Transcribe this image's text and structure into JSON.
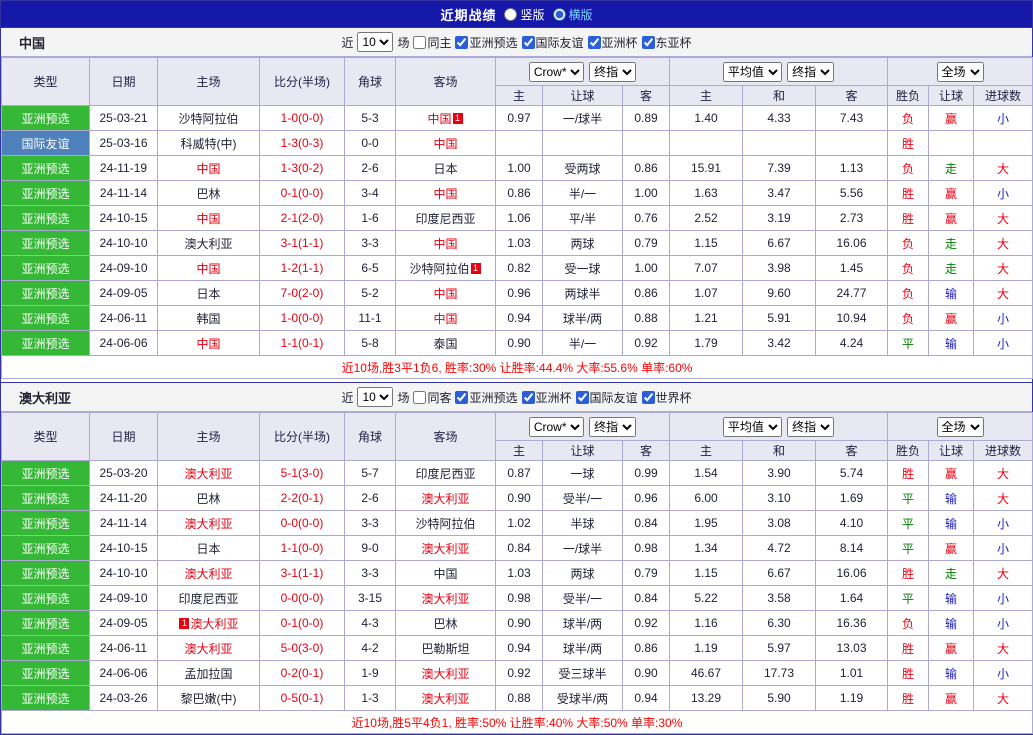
{
  "colors": {
    "topbar_bg": "#1518a8",
    "type_green": "#35b835",
    "type_blue": "#4f81bd",
    "red": "#e60012",
    "green": "#008000",
    "blue": "#2020cc",
    "header_bg": "#e8e8f2",
    "border": "#aaaad4",
    "selected_layout_label": "#7fd4ff",
    "summary_text": "#ff0000"
  },
  "topbar": {
    "title": "近期战绩",
    "options": [
      {
        "label": "竖版",
        "selected": false
      },
      {
        "label": "横版",
        "selected": true
      }
    ]
  },
  "sections": [
    {
      "team": "中国",
      "filter": {
        "near_label": "近",
        "count": "10",
        "games_label": "场",
        "same": {
          "label": "同主",
          "checked": false
        },
        "comps": [
          {
            "label": "亚洲预选",
            "checked": true
          },
          {
            "label": "国际友谊",
            "checked": true
          },
          {
            "label": "亚洲杯",
            "checked": true
          },
          {
            "label": "东亚杯",
            "checked": true
          }
        ]
      },
      "header": {
        "col_type": "类型",
        "col_date": "日期",
        "col_home": "主场",
        "col_score": "比分(半场)",
        "col_corner": "角球",
        "col_away": "客场",
        "odds_group1": [
          "Crow*",
          "终指"
        ],
        "odds_group2": [
          "平均值",
          "终指"
        ],
        "odds_group3": [
          "全场"
        ],
        "sub": [
          "主",
          "让球",
          "客",
          "主",
          "和",
          "客",
          "胜负",
          "让球",
          "进球数"
        ]
      },
      "rows": [
        {
          "type": "亚洲预选",
          "type_c": "green",
          "date": "25-03-21",
          "home": {
            "name": "沙特阿拉伯"
          },
          "score": "1-0(0-0)",
          "corner": "5-3",
          "away": {
            "name": "中国",
            "red": true,
            "badge_post": "1"
          },
          "odds1": [
            "0.97",
            "一/球半",
            "0.89"
          ],
          "odds2": [
            "1.40",
            "4.33",
            "7.43"
          ],
          "res": {
            "t": "负",
            "c": "r"
          },
          "handicap": {
            "t": "赢",
            "c": "r"
          },
          "goals": {
            "t": "小",
            "c": "b"
          }
        },
        {
          "type": "国际友谊",
          "type_c": "blue",
          "date": "25-03-16",
          "home": {
            "name": "科威特(中)"
          },
          "score": "1-3(0-3)",
          "corner": "0-0",
          "away": {
            "name": "中国",
            "red": true
          },
          "odds1": [
            "",
            "",
            ""
          ],
          "odds2": [
            "",
            "",
            ""
          ],
          "res": {
            "t": "胜",
            "c": "r"
          },
          "handicap": {
            "t": "",
            "c": "k"
          },
          "goals": {
            "t": "",
            "c": "k"
          }
        },
        {
          "type": "亚洲预选",
          "type_c": "green",
          "date": "24-11-19",
          "home": {
            "name": "中国",
            "red": true
          },
          "score": "1-3(0-2)",
          "corner": "2-6",
          "away": {
            "name": "日本"
          },
          "odds1": [
            "1.00",
            "受两球",
            "0.86"
          ],
          "odds2": [
            "15.91",
            "7.39",
            "1.13"
          ],
          "res": {
            "t": "负",
            "c": "r"
          },
          "handicap": {
            "t": "走",
            "c": "g"
          },
          "goals": {
            "t": "大",
            "c": "r"
          }
        },
        {
          "type": "亚洲预选",
          "type_c": "green",
          "date": "24-11-14",
          "home": {
            "name": "巴林"
          },
          "score": "0-1(0-0)",
          "corner": "3-4",
          "away": {
            "name": "中国",
            "red": true
          },
          "odds1": [
            "0.86",
            "半/一",
            "1.00"
          ],
          "odds2": [
            "1.63",
            "3.47",
            "5.56"
          ],
          "res": {
            "t": "胜",
            "c": "r"
          },
          "handicap": {
            "t": "赢",
            "c": "r"
          },
          "goals": {
            "t": "小",
            "c": "b"
          }
        },
        {
          "type": "亚洲预选",
          "type_c": "green",
          "date": "24-10-15",
          "home": {
            "name": "中国",
            "red": true
          },
          "score": "2-1(2-0)",
          "corner": "1-6",
          "away": {
            "name": "印度尼西亚"
          },
          "odds1": [
            "1.06",
            "平/半",
            "0.76"
          ],
          "odds2": [
            "2.52",
            "3.19",
            "2.73"
          ],
          "res": {
            "t": "胜",
            "c": "r"
          },
          "handicap": {
            "t": "赢",
            "c": "r"
          },
          "goals": {
            "t": "大",
            "c": "r"
          }
        },
        {
          "type": "亚洲预选",
          "type_c": "green",
          "date": "24-10-10",
          "home": {
            "name": "澳大利亚"
          },
          "score": "3-1(1-1)",
          "corner": "3-3",
          "away": {
            "name": "中国",
            "red": true
          },
          "odds1": [
            "1.03",
            "两球",
            "0.79"
          ],
          "odds2": [
            "1.15",
            "6.67",
            "16.06"
          ],
          "res": {
            "t": "负",
            "c": "r"
          },
          "handicap": {
            "t": "走",
            "c": "g"
          },
          "goals": {
            "t": "大",
            "c": "r"
          }
        },
        {
          "type": "亚洲预选",
          "type_c": "green",
          "date": "24-09-10",
          "home": {
            "name": "中国",
            "red": true
          },
          "score": "1-2(1-1)",
          "corner": "6-5",
          "away": {
            "name": "沙特阿拉伯",
            "badge_post": "1"
          },
          "odds1": [
            "0.82",
            "受一球",
            "1.00"
          ],
          "odds2": [
            "7.07",
            "3.98",
            "1.45"
          ],
          "res": {
            "t": "负",
            "c": "r"
          },
          "handicap": {
            "t": "走",
            "c": "g"
          },
          "goals": {
            "t": "大",
            "c": "r"
          }
        },
        {
          "type": "亚洲预选",
          "type_c": "green",
          "date": "24-09-05",
          "home": {
            "name": "日本"
          },
          "score": "7-0(2-0)",
          "corner": "5-2",
          "away": {
            "name": "中国",
            "red": true
          },
          "odds1": [
            "0.96",
            "两球半",
            "0.86"
          ],
          "odds2": [
            "1.07",
            "9.60",
            "24.77"
          ],
          "res": {
            "t": "负",
            "c": "r"
          },
          "handicap": {
            "t": "输",
            "c": "b"
          },
          "goals": {
            "t": "大",
            "c": "r"
          }
        },
        {
          "type": "亚洲预选",
          "type_c": "green",
          "date": "24-06-11",
          "home": {
            "name": "韩国"
          },
          "score": "1-0(0-0)",
          "corner": "11-1",
          "away": {
            "name": "中国",
            "red": true
          },
          "odds1": [
            "0.94",
            "球半/两",
            "0.88"
          ],
          "odds2": [
            "1.21",
            "5.91",
            "10.94"
          ],
          "res": {
            "t": "负",
            "c": "r"
          },
          "handicap": {
            "t": "赢",
            "c": "r"
          },
          "goals": {
            "t": "小",
            "c": "b"
          }
        },
        {
          "type": "亚洲预选",
          "type_c": "green",
          "date": "24-06-06",
          "home": {
            "name": "中国",
            "red": true
          },
          "score": "1-1(0-1)",
          "corner": "5-8",
          "away": {
            "name": "泰国"
          },
          "odds1": [
            "0.90",
            "半/一",
            "0.92"
          ],
          "odds2": [
            "1.79",
            "3.42",
            "4.24"
          ],
          "res": {
            "t": "平",
            "c": "g"
          },
          "handicap": {
            "t": "输",
            "c": "b"
          },
          "goals": {
            "t": "小",
            "c": "b"
          }
        }
      ],
      "summary": "近10场,胜3平1负6, 胜率:30% 让胜率:44.4% 大率:55.6% 单率:60%"
    },
    {
      "team": "澳大利亚",
      "filter": {
        "near_label": "近",
        "count": "10",
        "games_label": "场",
        "same": {
          "label": "同客",
          "checked": false
        },
        "comps": [
          {
            "label": "亚洲预选",
            "checked": true
          },
          {
            "label": "亚洲杯",
            "checked": true
          },
          {
            "label": "国际友谊",
            "checked": true
          },
          {
            "label": "世界杯",
            "checked": true
          }
        ]
      },
      "header": {
        "col_type": "类型",
        "col_date": "日期",
        "col_home": "主场",
        "col_score": "比分(半场)",
        "col_corner": "角球",
        "col_away": "客场",
        "odds_group1": [
          "Crow*",
          "终指"
        ],
        "odds_group2": [
          "平均值",
          "终指"
        ],
        "odds_group3": [
          "全场"
        ],
        "sub": [
          "主",
          "让球",
          "客",
          "主",
          "和",
          "客",
          "胜负",
          "让球",
          "进球数"
        ]
      },
      "rows": [
        {
          "type": "亚洲预选",
          "type_c": "green",
          "date": "25-03-20",
          "home": {
            "name": "澳大利亚",
            "red": true
          },
          "score": "5-1(3-0)",
          "corner": "5-7",
          "away": {
            "name": "印度尼西亚"
          },
          "odds1": [
            "0.87",
            "一球",
            "0.99"
          ],
          "odds2": [
            "1.54",
            "3.90",
            "5.74"
          ],
          "res": {
            "t": "胜",
            "c": "r"
          },
          "handicap": {
            "t": "赢",
            "c": "r"
          },
          "goals": {
            "t": "大",
            "c": "r"
          }
        },
        {
          "type": "亚洲预选",
          "type_c": "green",
          "date": "24-11-20",
          "home": {
            "name": "巴林"
          },
          "score": "2-2(0-1)",
          "corner": "2-6",
          "away": {
            "name": "澳大利亚",
            "red": true
          },
          "odds1": [
            "0.90",
            "受半/一",
            "0.96"
          ],
          "odds2": [
            "6.00",
            "3.10",
            "1.69"
          ],
          "res": {
            "t": "平",
            "c": "g"
          },
          "handicap": {
            "t": "输",
            "c": "b"
          },
          "goals": {
            "t": "大",
            "c": "r"
          }
        },
        {
          "type": "亚洲预选",
          "type_c": "green",
          "date": "24-11-14",
          "home": {
            "name": "澳大利亚",
            "red": true
          },
          "score": "0-0(0-0)",
          "corner": "3-3",
          "away": {
            "name": "沙特阿拉伯"
          },
          "odds1": [
            "1.02",
            "半球",
            "0.84"
          ],
          "odds2": [
            "1.95",
            "3.08",
            "4.10"
          ],
          "res": {
            "t": "平",
            "c": "g"
          },
          "handicap": {
            "t": "输",
            "c": "b"
          },
          "goals": {
            "t": "小",
            "c": "b"
          }
        },
        {
          "type": "亚洲预选",
          "type_c": "green",
          "date": "24-10-15",
          "home": {
            "name": "日本"
          },
          "score": "1-1(0-0)",
          "corner": "9-0",
          "away": {
            "name": "澳大利亚",
            "red": true
          },
          "odds1": [
            "0.84",
            "一/球半",
            "0.98"
          ],
          "odds2": [
            "1.34",
            "4.72",
            "8.14"
          ],
          "res": {
            "t": "平",
            "c": "g"
          },
          "handicap": {
            "t": "赢",
            "c": "r"
          },
          "goals": {
            "t": "小",
            "c": "b"
          }
        },
        {
          "type": "亚洲预选",
          "type_c": "green",
          "date": "24-10-10",
          "home": {
            "name": "澳大利亚",
            "red": true
          },
          "score": "3-1(1-1)",
          "corner": "3-3",
          "away": {
            "name": "中国"
          },
          "odds1": [
            "1.03",
            "两球",
            "0.79"
          ],
          "odds2": [
            "1.15",
            "6.67",
            "16.06"
          ],
          "res": {
            "t": "胜",
            "c": "r"
          },
          "handicap": {
            "t": "走",
            "c": "g"
          },
          "goals": {
            "t": "大",
            "c": "r"
          }
        },
        {
          "type": "亚洲预选",
          "type_c": "green",
          "date": "24-09-10",
          "home": {
            "name": "印度尼西亚"
          },
          "score": "0-0(0-0)",
          "corner": "3-15",
          "away": {
            "name": "澳大利亚",
            "red": true
          },
          "odds1": [
            "0.98",
            "受半/一",
            "0.84"
          ],
          "odds2": [
            "5.22",
            "3.58",
            "1.64"
          ],
          "res": {
            "t": "平",
            "c": "g"
          },
          "handicap": {
            "t": "输",
            "c": "b"
          },
          "goals": {
            "t": "小",
            "c": "b"
          }
        },
        {
          "type": "亚洲预选",
          "type_c": "green",
          "date": "24-09-05",
          "home": {
            "name": "澳大利亚",
            "red": true,
            "badge_pre": "1"
          },
          "score": "0-1(0-0)",
          "corner": "4-3",
          "away": {
            "name": "巴林"
          },
          "odds1": [
            "0.90",
            "球半/两",
            "0.92"
          ],
          "odds2": [
            "1.16",
            "6.30",
            "16.36"
          ],
          "res": {
            "t": "负",
            "c": "r"
          },
          "handicap": {
            "t": "输",
            "c": "b"
          },
          "goals": {
            "t": "小",
            "c": "b"
          }
        },
        {
          "type": "亚洲预选",
          "type_c": "green",
          "date": "24-06-11",
          "home": {
            "name": "澳大利亚",
            "red": true
          },
          "score": "5-0(3-0)",
          "corner": "4-2",
          "away": {
            "name": "巴勒斯坦"
          },
          "odds1": [
            "0.94",
            "球半/两",
            "0.86"
          ],
          "odds2": [
            "1.19",
            "5.97",
            "13.03"
          ],
          "res": {
            "t": "胜",
            "c": "r"
          },
          "handicap": {
            "t": "赢",
            "c": "r"
          },
          "goals": {
            "t": "大",
            "c": "r"
          }
        },
        {
          "type": "亚洲预选",
          "type_c": "green",
          "date": "24-06-06",
          "home": {
            "name": "孟加拉国"
          },
          "score": "0-2(0-1)",
          "corner": "1-9",
          "away": {
            "name": "澳大利亚",
            "red": true
          },
          "odds1": [
            "0.92",
            "受三球半",
            "0.90"
          ],
          "odds2": [
            "46.67",
            "17.73",
            "1.01"
          ],
          "res": {
            "t": "胜",
            "c": "r"
          },
          "handicap": {
            "t": "输",
            "c": "b"
          },
          "goals": {
            "t": "小",
            "c": "b"
          }
        },
        {
          "type": "亚洲预选",
          "type_c": "green",
          "date": "24-03-26",
          "home": {
            "name": "黎巴嫩(中)"
          },
          "score": "0-5(0-1)",
          "corner": "1-3",
          "away": {
            "name": "澳大利亚",
            "red": true
          },
          "odds1": [
            "0.88",
            "受球半/两",
            "0.94"
          ],
          "odds2": [
            "13.29",
            "5.90",
            "1.19"
          ],
          "res": {
            "t": "胜",
            "c": "r"
          },
          "handicap": {
            "t": "赢",
            "c": "r"
          },
          "goals": {
            "t": "大",
            "c": "r"
          }
        }
      ],
      "summary": "近10场,胜5平4负1, 胜率:50% 让胜率:40% 大率:50% 单率:30%"
    }
  ]
}
